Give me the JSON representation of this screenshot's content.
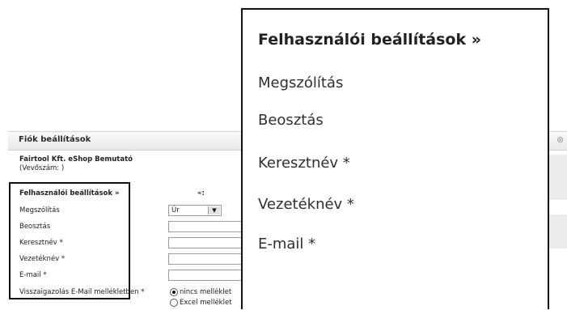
{
  "dialog": {
    "title": "Fiók beállítások",
    "close_glyph": "⊗",
    "company": "Fairtool Kft. eShop Bemutató",
    "customer_number": "(Vevőszám:        )"
  },
  "user_settings": {
    "section_title": "Felhasználói beállítások »",
    "collapse_glyph": "«:",
    "fields": {
      "salutation": {
        "label": "Megszólítás",
        "value": "Úr",
        "dropdown_glyph": "▼"
      },
      "position": {
        "label": "Beosztás",
        "value": ""
      },
      "first_name": {
        "label": "Keresztnév *",
        "value": ""
      },
      "last_name": {
        "label": "Vezetéknév *",
        "value": ""
      },
      "email": {
        "label": "E-mail *",
        "value": ""
      },
      "confirmation": {
        "label": "Visszaigazolás E-Mail mellékletben *",
        "options": [
          {
            "label": "nincs melléklet",
            "selected": true
          },
          {
            "label": "Excel melléklet",
            "selected": false
          }
        ]
      }
    }
  },
  "zoom": {
    "title": "Felhasználói beállítások »",
    "labels": [
      "Megszólítás",
      "Beosztás",
      "Keresztnév *",
      "Vezetéknév *",
      "E-mail *"
    ]
  }
}
